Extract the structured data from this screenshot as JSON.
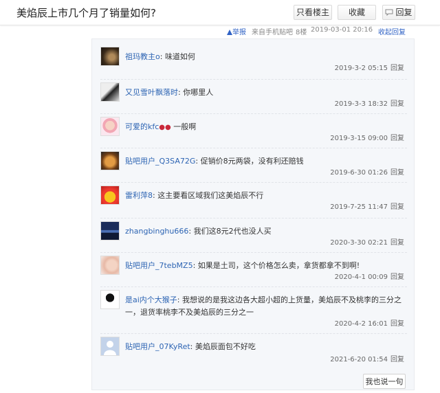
{
  "header": {
    "title": "美焰辰上市几个月了销量如何?",
    "louzhu_label": "只看楼主",
    "shoucang_label": "收藏",
    "reply_label": "回复"
  },
  "meta": {
    "report": "举报",
    "client": "来自手机贴吧",
    "floor": "8楼",
    "time": "2019-03-01 20:16",
    "collapse": "收起回复",
    "reply": ""
  },
  "comments": [
    {
      "user": "祖玛教主o",
      "text": "味道如何",
      "time": "2019-3-2 05:15",
      "reply": "回复",
      "avatar": "dark-photo"
    },
    {
      "user": "又见雪叶飘落时",
      "text": "你哪里人",
      "time": "2019-3-3 18:32",
      "reply": "回复",
      "avatar": "bw-photo"
    },
    {
      "user": "可爱的kfc",
      "text": "一般啊",
      "time": "2019-3-15 09:00",
      "reply": "回复",
      "avatar": "cartoon-girl"
    },
    {
      "user": "贴吧用户_Q3SA72G",
      "text": "促销价8元两袋，没有利还赔钱",
      "time": "2019-6-30 01:26",
      "reply": "回复",
      "avatar": "cat"
    },
    {
      "user": "雷利萍8",
      "text": "这主要看区域我们这美焰辰不行",
      "time": "2019-7-25 11:47",
      "reply": "回复",
      "avatar": "yellow-duck"
    },
    {
      "user": "zhangbinghu666",
      "text": "我们这8元2代也没人买",
      "time": "2020-3-30 02:21",
      "reply": "回复",
      "avatar": "blue-landscape"
    },
    {
      "user": "贴吧用户_7tebMZ5",
      "text": "如果是土司，这个价格怎么卖，拿货都拿不到啊!",
      "time": "2020-4-1 00:09",
      "reply": "回复",
      "avatar": "hand"
    },
    {
      "user": "是ai内个大猴子",
      "text": "我想说的是我这边各大超小超的上货量，美焰辰不及桃李的三分之一，退货率桃李不及美焰辰的三分之一",
      "time": "2020-4-2 16:01",
      "reply": "回复",
      "avatar": "meme"
    },
    {
      "user": "贴吧用户_07KyRet",
      "text": "美焰辰面包不好吃",
      "time": "2021-6-20 01:54",
      "reply": "回复",
      "avatar": "default"
    }
  ],
  "say_button": "我也说一句",
  "colors": {
    "username": "#2d64b3",
    "link": "#3163c5",
    "panel": "#f5f7fa"
  }
}
